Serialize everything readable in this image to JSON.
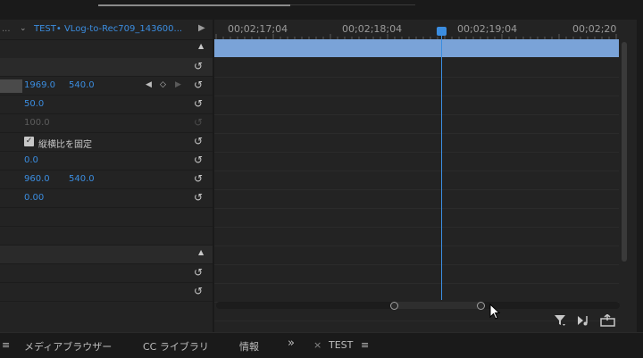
{
  "sequence_tab": {
    "chevron": "⌄",
    "title": "TEST• VLog-to-Rec709_143600...",
    "menu_dots": "...",
    "play_icon": "play-triangle-icon"
  },
  "properties": [
    {
      "kind": "group"
    },
    {
      "kind": "value",
      "v1": "1969.0",
      "v2": "540.0",
      "has_keyframe_nav": true,
      "has_swatch": true
    },
    {
      "kind": "value",
      "v1": "50.0"
    },
    {
      "kind": "value",
      "v1": "100.0",
      "dim": true
    },
    {
      "kind": "checkbox",
      "label": "縦横比を固定",
      "checked": true
    },
    {
      "kind": "value",
      "v1": "0.0"
    },
    {
      "kind": "value",
      "v1": "960.0",
      "v2": "540.0"
    },
    {
      "kind": "value",
      "v1": "0.00"
    },
    {
      "kind": "empty"
    },
    {
      "kind": "empty"
    },
    {
      "kind": "group"
    },
    {
      "kind": "value"
    },
    {
      "kind": "value"
    }
  ],
  "timecodes": [
    "00;02;17;04",
    "00;02;18;04",
    "00;02;19;04",
    "00;02;20"
  ],
  "icons": {
    "reset": "reset-arrow-icon",
    "keyframe_prev": "◀",
    "keyframe_add": "◇",
    "keyframe_next": "▶"
  },
  "bottom_icons": [
    "filter-icon",
    "audio-clip-icon",
    "export-frame-icon"
  ],
  "tabs": {
    "menu": "≡",
    "media_browser": "メディアブラウザー",
    "cc_libraries": "CC ライブラリ",
    "info": "情報",
    "more": "»",
    "close": "×",
    "test": "TEST",
    "test_menu": "≡"
  },
  "colors": {
    "accent": "#3b8de0",
    "clip": "#7aa3d8",
    "panel": "#232323"
  }
}
